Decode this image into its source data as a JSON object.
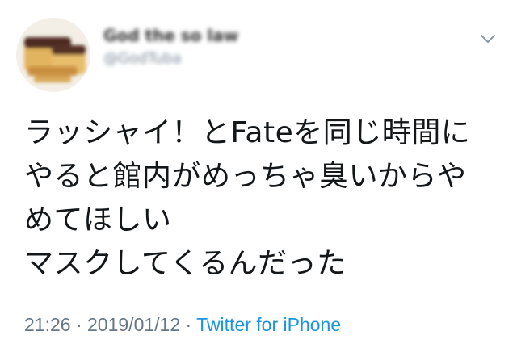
{
  "tweet": {
    "author": {
      "display_name": "God the so law",
      "handle": "@GodTuba"
    },
    "body_lines": [
      "ラッシャイ！とFateを同じ時間に",
      "やると館内がめっちゃ臭いからや",
      "めてほしい",
      "マスクしてくるんだった"
    ],
    "meta": {
      "time": "21:26",
      "separator1": " · ",
      "date": "2019/01/12",
      "separator2": " · ",
      "source": "Twitter for iPhone"
    },
    "icons": {
      "caret": "chevron-down-icon",
      "avatar": "avatar-image"
    },
    "colors": {
      "text": "#14171a",
      "meta": "#657786",
      "link": "#1b95e0"
    }
  }
}
